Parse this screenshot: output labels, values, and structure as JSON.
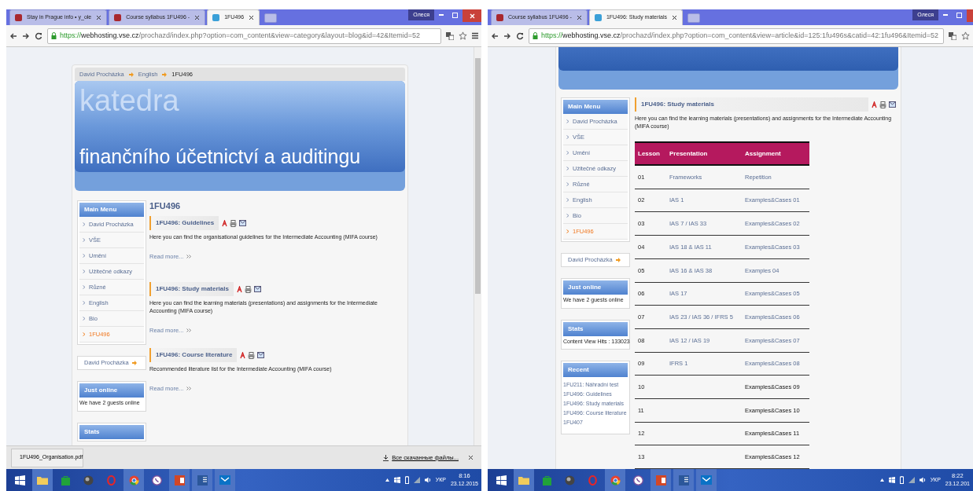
{
  "left": {
    "tabs": [
      {
        "title": "Stay in Prague info • y_ole",
        "selected": false
      },
      {
        "title": "Course syllabus 1FU496 - ",
        "selected": false
      },
      {
        "title": "1FU496",
        "selected": true
      }
    ],
    "user": "Олеся",
    "url": {
      "scheme": "https://",
      "host": "webhosting.vse.cz",
      "path": "/prochazd/index.php?option=com_content&view=category&layout=blog&id=42&Itemid=52"
    },
    "breadcrumb": [
      "David Procházka",
      "English",
      "1FU496"
    ],
    "banner": {
      "line1": "katedra",
      "line2": "finančního účetnictví a auditingu"
    },
    "main_menu": {
      "title": "Main Menu",
      "items": [
        {
          "label": "David Procházka",
          "selected": false
        },
        {
          "label": "VŠE",
          "selected": false
        },
        {
          "label": "Umění",
          "selected": false
        },
        {
          "label": "Užitečné odkazy",
          "selected": false
        },
        {
          "label": "Různé",
          "selected": false
        },
        {
          "label": "English",
          "selected": false
        },
        {
          "label": "Bio",
          "selected": false
        },
        {
          "label": "1FU496",
          "selected": true
        }
      ]
    },
    "author": "David Procházka",
    "just_online": {
      "title": "Just online",
      "text": "We have 2 guests online"
    },
    "stats": {
      "title": "Stats"
    },
    "page_title": "1FU496",
    "articles": [
      {
        "title": "1FU496: Guidelines",
        "text": "Here you can find the organisational guidelines for the Intermediate Accounting (MIFA course)",
        "read_more": "Read more..."
      },
      {
        "title": "1FU496: Study materials",
        "text": "Here you can find the learning materials (presentations) and assignments for the Intermediate Accounting (MIFA course)",
        "read_more": "Read more..."
      },
      {
        "title": "1FU496: Course literature",
        "text": "Recommended literature list for the Intermediate Accounting (MIFA course)",
        "read_more": "Read more..."
      }
    ],
    "download": {
      "file": "1FU496_Organisation.pdf",
      "all": "Все скачанные файлы..."
    },
    "taskbar": {
      "lang": "УКР",
      "time": "8:16",
      "date": "23.12.2015"
    }
  },
  "right": {
    "tabs": [
      {
        "title": "Course syllabus 1FU496 - ",
        "selected": false
      },
      {
        "title": "1FU496: Study materials",
        "selected": true
      }
    ],
    "user": "Олеся",
    "url": {
      "scheme": "https://",
      "host": "webhosting.vse.cz",
      "path": "/prochazd/index.php?option=com_content&view=article&id=125:1fu496s&catid=42:1fu496&Itemid=52"
    },
    "main_menu": {
      "title": "Main Menu",
      "items": [
        {
          "label": "David Procházka",
          "selected": false
        },
        {
          "label": "VŠE",
          "selected": false
        },
        {
          "label": "Umění",
          "selected": false
        },
        {
          "label": "Užitečné odkazy",
          "selected": false
        },
        {
          "label": "Různé",
          "selected": false
        },
        {
          "label": "English",
          "selected": false
        },
        {
          "label": "Bio",
          "selected": false
        },
        {
          "label": "1FU496",
          "selected": true
        }
      ]
    },
    "author": "David Procházka",
    "just_online": {
      "title": "Just online",
      "text": "We have 2 guests online"
    },
    "stats": {
      "title": "Stats",
      "text": "Content View Hits : 133023"
    },
    "recent": {
      "title": "Recent",
      "items": [
        "1FU211: Náhradní test",
        "1FU496: Guidelines",
        "1FU496: Study materials",
        "1FU496: Course literature",
        "1FU407"
      ]
    },
    "article": {
      "title": "1FU496: Study materials",
      "text": "Here you can find the learning materials (presentations) and assignments for the Intermediate Accounting (MIFA course)"
    },
    "table": {
      "columns": [
        "Lesson",
        "Presentation",
        "Assignment"
      ],
      "rows": [
        {
          "lesson": "01",
          "presentation": "Frameworks",
          "assignment": "Repetition",
          "link": true
        },
        {
          "lesson": "02",
          "presentation": "IAS 1",
          "assignment": "Examples&Cases 01",
          "link": true
        },
        {
          "lesson": "03",
          "presentation": "IAS 7 / IAS 33",
          "assignment": "Examples&Cases 02",
          "link": true
        },
        {
          "lesson": "04",
          "presentation": "IAS 18 & IAS 11",
          "assignment": "Examples&Cases 03",
          "link": true
        },
        {
          "lesson": "05",
          "presentation": "IAS 16 & IAS 38",
          "assignment": "Examples 04",
          "link": true
        },
        {
          "lesson": "06",
          "presentation": "IAS 17",
          "assignment": "Examples&Cases 05",
          "link": true
        },
        {
          "lesson": "07",
          "presentation": "IAS 23 / IAS 36 / IFRS 5",
          "assignment": "Examples&Cases 06",
          "link": true
        },
        {
          "lesson": "08",
          "presentation": "IAS 12 / IAS 19",
          "assignment": "Examples&Cases 07",
          "link": true
        },
        {
          "lesson": "09",
          "presentation": "IFRS 1",
          "assignment": "Examples&Cases 08",
          "link": true
        },
        {
          "lesson": "10",
          "assignment": "Examples&Cases 09",
          "link": false
        },
        {
          "lesson": "11",
          "assignment": "Examples&Cases 10",
          "link": false
        },
        {
          "lesson": "12",
          "assignment": "Examples&Cases 11",
          "link": false
        },
        {
          "lesson": "13",
          "assignment": "Examples&Cases 12",
          "link": false
        }
      ]
    },
    "taskbar": {
      "lang": "УКР",
      "time": "8:22",
      "date": "23.12.201"
    }
  }
}
